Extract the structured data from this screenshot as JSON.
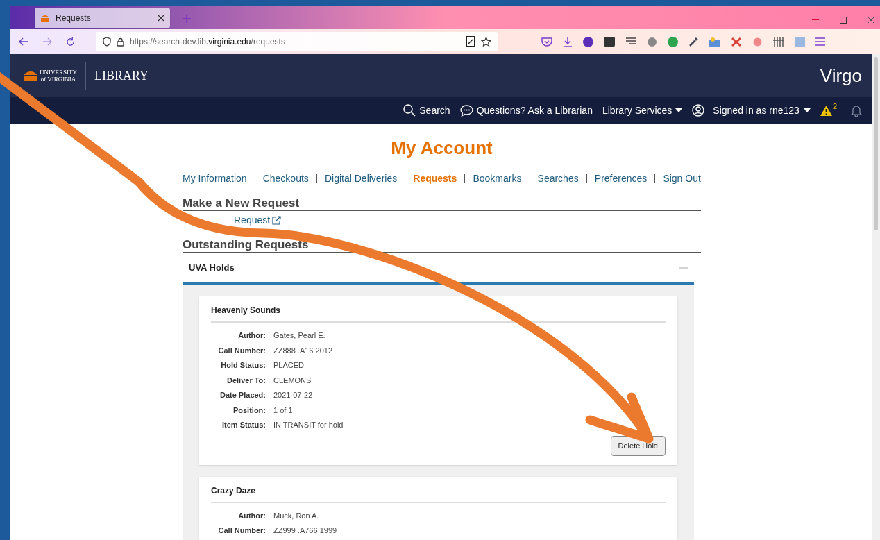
{
  "browser": {
    "tab": {
      "title": "Requests",
      "selected": true
    },
    "url": {
      "host_prefix": "https://search-dev.lib.",
      "host_main": "virginia.edu",
      "path": "/requests"
    }
  },
  "site_header": {
    "logo_lines": [
      "UNIVERSITY",
      "of VIRGINIA"
    ],
    "logo_text": "LIBRARY",
    "app_name": "Virgo"
  },
  "top_nav": [
    {
      "kind": "search",
      "label": "Search"
    },
    {
      "kind": "chat",
      "label": "Questions? Ask a Librarian"
    },
    {
      "kind": "menu",
      "label": "Library Services"
    },
    {
      "kind": "user",
      "label": "Signed in as rne123"
    },
    {
      "kind": "alert",
      "label": "2"
    },
    {
      "kind": "bell"
    }
  ],
  "page_title": "My Account",
  "account_tabs": [
    {
      "label": "My Information",
      "selected": false
    },
    {
      "label": "Checkouts",
      "selected": false
    },
    {
      "label": "Digital Deliveries",
      "selected": false
    },
    {
      "label": "Requests",
      "selected": true
    },
    {
      "label": "Bookmarks",
      "selected": false
    },
    {
      "label": "Searches",
      "selected": false
    },
    {
      "label": "Preferences",
      "selected": false
    },
    {
      "label": "Sign Out",
      "selected": false
    }
  ],
  "new_request": {
    "heading": "Make a New Request",
    "link": "Request"
  },
  "outstanding": {
    "heading": "Outstanding Requests",
    "panel": {
      "title": "UVA Holds",
      "expanded": true,
      "holds": [
        {
          "title": "Heavenly Sounds",
          "fields": [
            {
              "label": "Author:",
              "value": "Gates, Pearl E."
            },
            {
              "label": "Call Number:",
              "value": "ZZ888 .A16 2012"
            },
            {
              "label": "Hold Status:",
              "value": "PLACED"
            },
            {
              "label": "Deliver To:",
              "value": "CLEMONS"
            },
            {
              "label": "Date Placed:",
              "value": "2021-07-22"
            },
            {
              "label": "Position:",
              "value": "1 of 1"
            },
            {
              "label": "Item Status:",
              "value": "IN TRANSIT for hold"
            }
          ],
          "button": "Delete Hold"
        },
        {
          "title": "Crazy Daze",
          "fields": [
            {
              "label": "Author:",
              "value": "Muck, Ron A."
            },
            {
              "label": "Call Number:",
              "value": "ZZ999 .A766 1999"
            }
          ]
        }
      ]
    }
  }
}
